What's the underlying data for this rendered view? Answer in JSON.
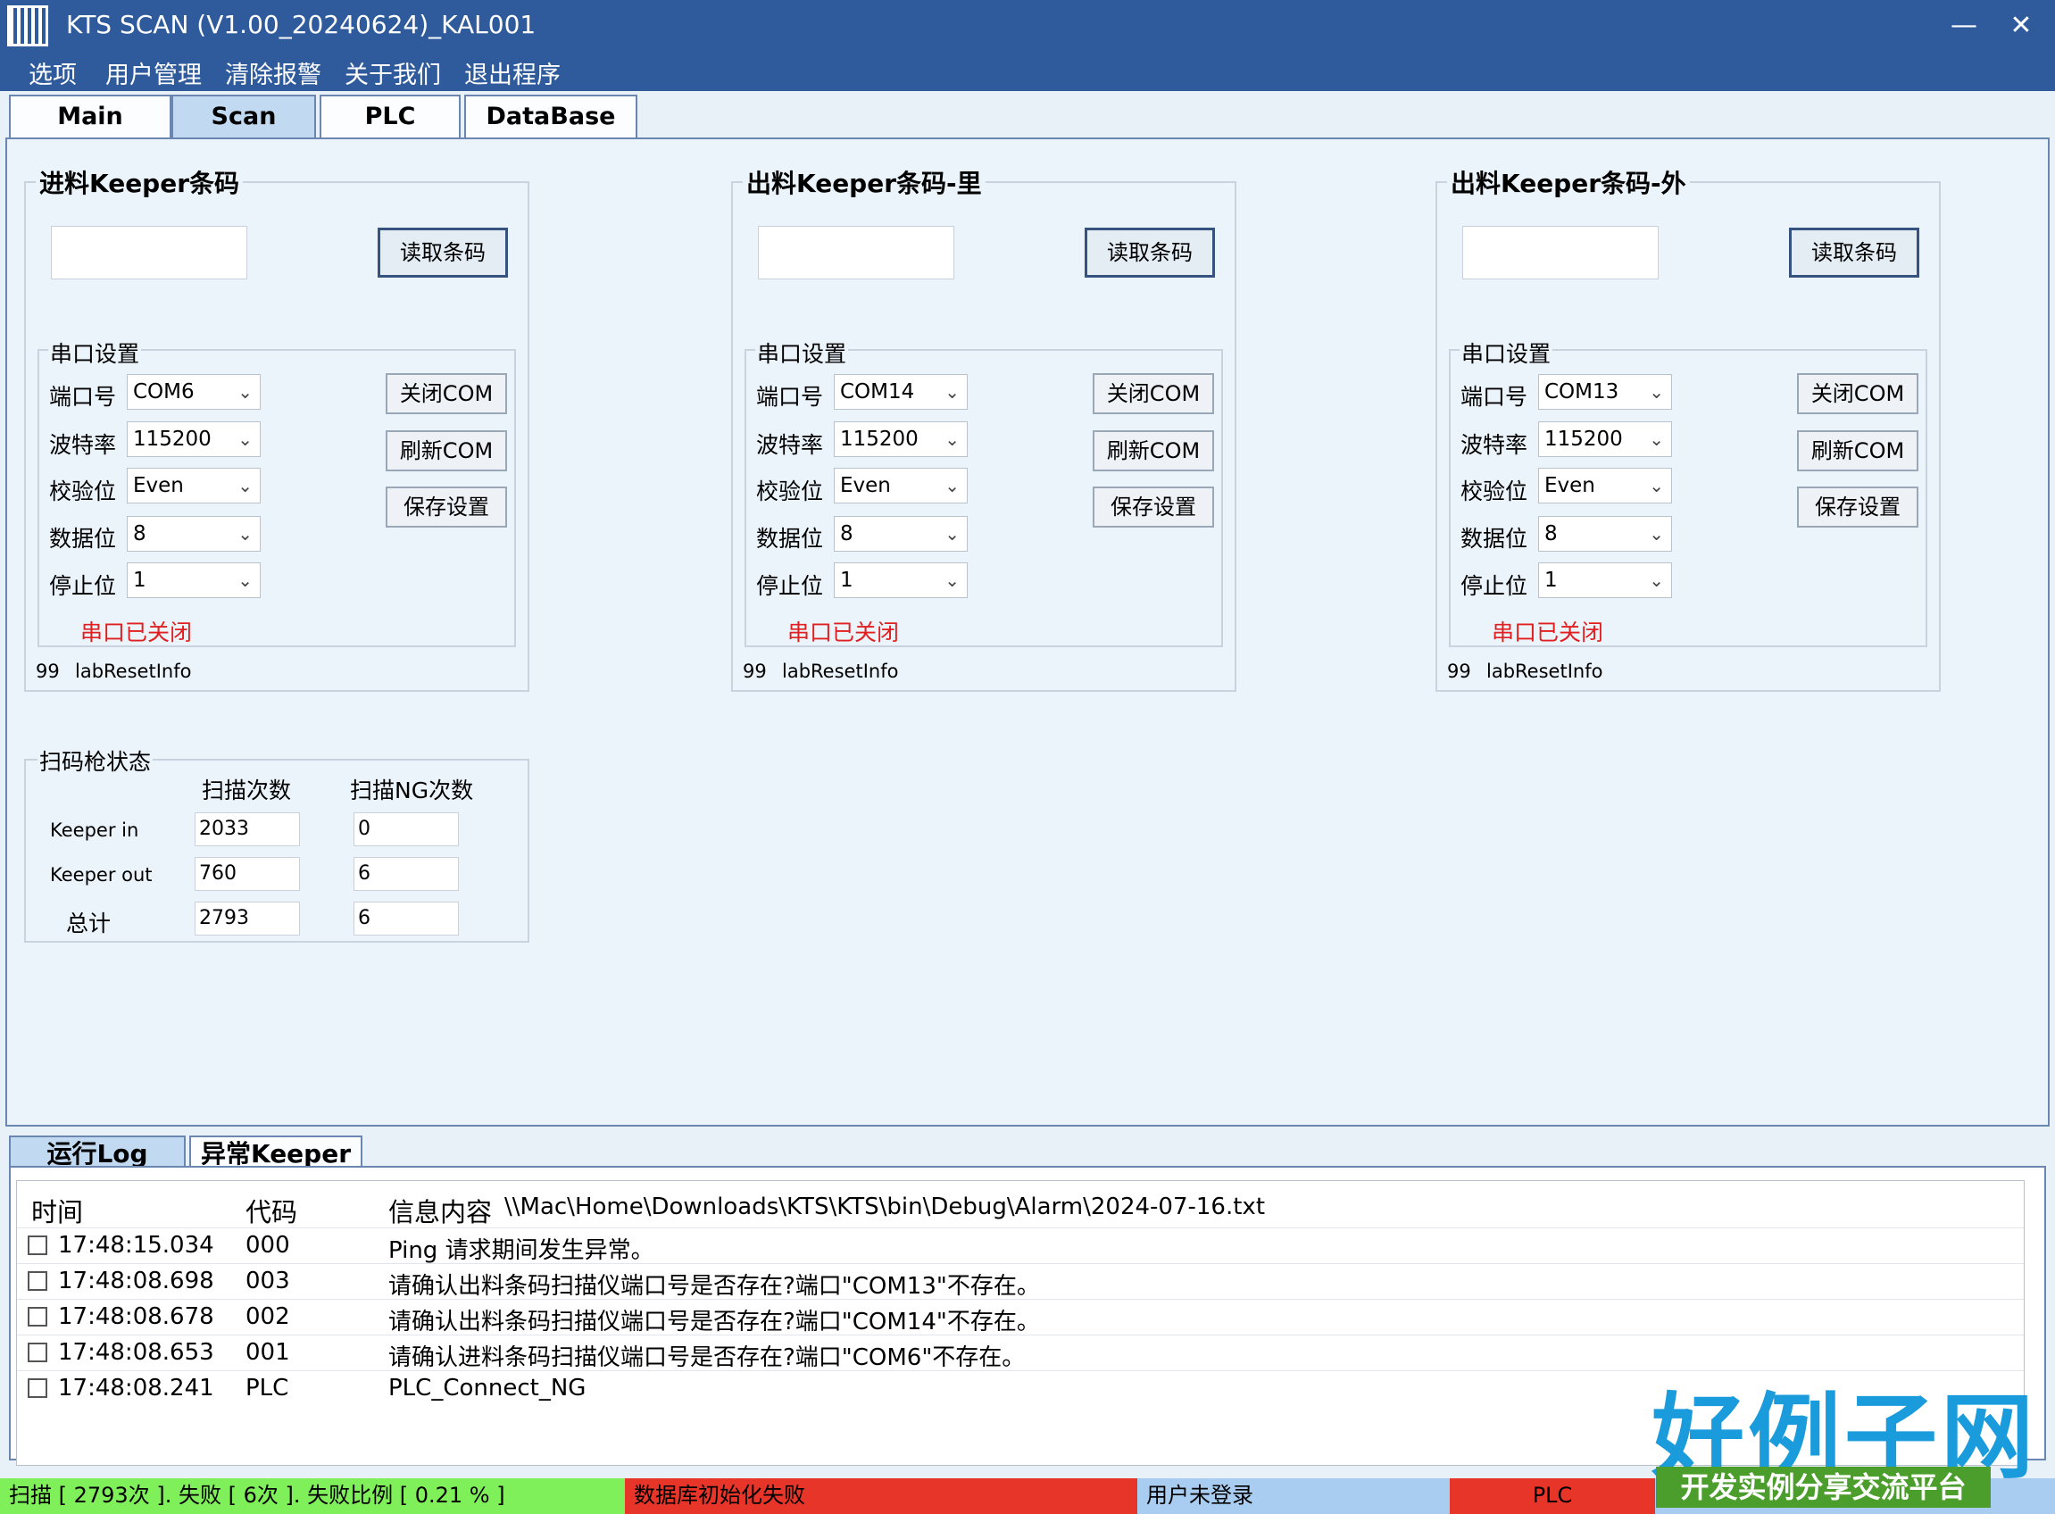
{
  "window": {
    "title": "KTS SCAN (V1.00_20240624)_KAL001",
    "minimize": "—",
    "close": "✕"
  },
  "menu": [
    "选项",
    "用户管理",
    "清除报警",
    "关于我们",
    "退出程序"
  ],
  "tabs": [
    "Main",
    "Scan",
    "PLC",
    "DataBase"
  ],
  "scanners": [
    {
      "title": "进料Keeper条码",
      "read_button": "读取条码",
      "serial_title": "串口设置",
      "fields": [
        {
          "label": "端口号",
          "value": "COM6"
        },
        {
          "label": "波特率",
          "value": "115200"
        },
        {
          "label": "校验位",
          "value": "Even"
        },
        {
          "label": "数据位",
          "value": "8"
        },
        {
          "label": "停止位",
          "value": "1"
        }
      ],
      "buttons": [
        "关闭COM",
        "刷新COM",
        "保存设置"
      ],
      "status": "串口已关闭",
      "reset_count": "99",
      "reset_label": "labResetInfo"
    },
    {
      "title": "出料Keeper条码-里",
      "read_button": "读取条码",
      "serial_title": "串口设置",
      "fields": [
        {
          "label": "端口号",
          "value": "COM14"
        },
        {
          "label": "波特率",
          "value": "115200"
        },
        {
          "label": "校验位",
          "value": "Even"
        },
        {
          "label": "数据位",
          "value": "8"
        },
        {
          "label": "停止位",
          "value": "1"
        }
      ],
      "buttons": [
        "关闭COM",
        "刷新COM",
        "保存设置"
      ],
      "status": "串口已关闭",
      "reset_count": "99",
      "reset_label": "labResetInfo"
    },
    {
      "title": "出料Keeper条码-外",
      "read_button": "读取条码",
      "serial_title": "串口设置",
      "fields": [
        {
          "label": "端口号",
          "value": "COM13"
        },
        {
          "label": "波特率",
          "value": "115200"
        },
        {
          "label": "校验位",
          "value": "Even"
        },
        {
          "label": "数据位",
          "value": "8"
        },
        {
          "label": "停止位",
          "value": "1"
        }
      ],
      "buttons": [
        "关闭COM",
        "刷新COM",
        "保存设置"
      ],
      "status": "串口已关闭",
      "reset_count": "99",
      "reset_label": "labResetInfo"
    }
  ],
  "scan_status": {
    "title": "扫码枪状态",
    "col_scan": "扫描次数",
    "col_ng": "扫描NG次数",
    "rows": [
      {
        "label": "Keeper in",
        "scan": "2033",
        "ng": "0"
      },
      {
        "label": "Keeper out",
        "scan": "760",
        "ng": "6"
      },
      {
        "label": "总计",
        "scan": "2793",
        "ng": "6"
      }
    ]
  },
  "log_tabs": [
    "运行Log",
    "异常Keeper"
  ],
  "log": {
    "headers": {
      "time": "时间",
      "code": "代码",
      "info": "信息内容",
      "path": "\\\\Mac\\Home\\Downloads\\KTS\\KTS\\bin\\Debug\\Alarm\\2024-07-16.txt"
    },
    "rows": [
      {
        "time": "17:48:15.034",
        "code": "000",
        "info": "Ping 请求期间发生异常。"
      },
      {
        "time": "17:48:08.698",
        "code": "003",
        "info": "请确认出料条码扫描仪端口号是否存在?端口\"COM13\"不存在。"
      },
      {
        "time": "17:48:08.678",
        "code": "002",
        "info": "请确认出料条码扫描仪端口号是否存在?端口\"COM14\"不存在。"
      },
      {
        "time": "17:48:08.653",
        "code": "001",
        "info": "请确认进料条码扫描仪端口号是否存在?端口\"COM6\"不存在。"
      },
      {
        "time": "17:48:08.241",
        "code": "PLC",
        "info": "PLC_Connect_NG"
      }
    ]
  },
  "statusbar": {
    "scan": "扫描 [ 2793次 ]. 失败 [ 6次 ]. 失败比例 [ 0.21 % ]",
    "db": "数据库初始化失败",
    "user": "用户未登录",
    "plc": "PLC"
  },
  "overlay": {
    "logo": "好例子网",
    "slogan": "开发实例分享交流平台"
  },
  "colors": {
    "titlebar": "#2f5b9c",
    "status_ok": "#7ff05a",
    "status_err": "#e8352a",
    "status_user": "#a8cdf0",
    "status_closed_text": "#e02020"
  }
}
